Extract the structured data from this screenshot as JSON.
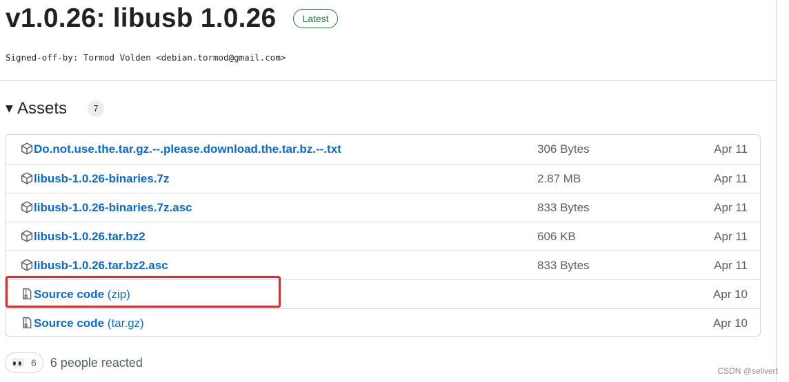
{
  "release": {
    "title": "v1.0.26: libusb 1.0.26",
    "badge": "Latest",
    "signed_off": "Signed-off-by: Tormod Volden <debian.tormod@gmail.com>"
  },
  "assets": {
    "label": "Assets",
    "count": "7",
    "items": [
      {
        "name": "Do.not.use.the.tar.gz.--.please.download.the.tar.bz.--.txt",
        "suffix": "",
        "size": "306 Bytes",
        "date": "Apr 11",
        "icon": "package-icon"
      },
      {
        "name": "libusb-1.0.26-binaries.7z",
        "suffix": "",
        "size": "2.87 MB",
        "date": "Apr 11",
        "icon": "package-icon"
      },
      {
        "name": "libusb-1.0.26-binaries.7z.asc",
        "suffix": "",
        "size": "833 Bytes",
        "date": "Apr 11",
        "icon": "package-icon"
      },
      {
        "name": "libusb-1.0.26.tar.bz2",
        "suffix": "",
        "size": "606 KB",
        "date": "Apr 11",
        "icon": "package-icon"
      },
      {
        "name": "libusb-1.0.26.tar.bz2.asc",
        "suffix": "",
        "size": "833 Bytes",
        "date": "Apr 11",
        "icon": "package-icon"
      },
      {
        "name": "Source code",
        "suffix": "(zip)",
        "size": "",
        "date": "Apr 10",
        "icon": "file-zip-icon"
      },
      {
        "name": "Source code",
        "suffix": "(tar.gz)",
        "size": "",
        "date": "Apr 10",
        "icon": "file-zip-icon"
      }
    ]
  },
  "reactions": {
    "emoji": "eyes-icon",
    "count": "6",
    "text": "6 people reacted"
  },
  "watermark": "CSDN @selivert",
  "colors": {
    "link": "#0969da",
    "latest_badge": "#1a7f37",
    "highlight": "#e8292a",
    "muted": "#57606a",
    "border": "#d0d7de"
  }
}
